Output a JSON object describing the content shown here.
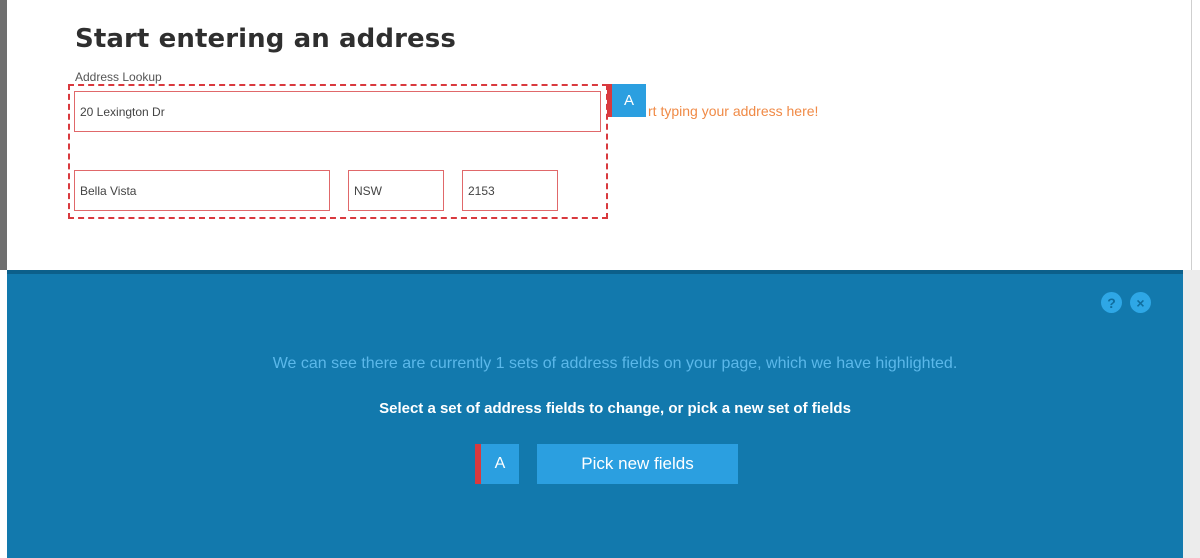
{
  "page": {
    "heading": "Start entering an address",
    "lookup_label": "Address Lookup",
    "hint": "rt typing your address here!"
  },
  "address_set": {
    "tag": "A",
    "fields": {
      "street": "20 Lexington Dr",
      "suburb": "Bella Vista",
      "state": "NSW",
      "postcode": "2153"
    }
  },
  "panel": {
    "help_icon": "?",
    "close_icon": "×",
    "info_text": "We can see there are currently 1 sets of address fields on your page, which we have highlighted.",
    "instruction": "Select a set of address fields to change, or pick a new set of fields",
    "set_tag": "A",
    "pick_button": "Pick new fields"
  },
  "colors": {
    "panel_bg": "#1279ad",
    "accent_blue": "#2b9fe0",
    "highlight_red": "#d9393e",
    "hint_orange": "#f08a46"
  }
}
